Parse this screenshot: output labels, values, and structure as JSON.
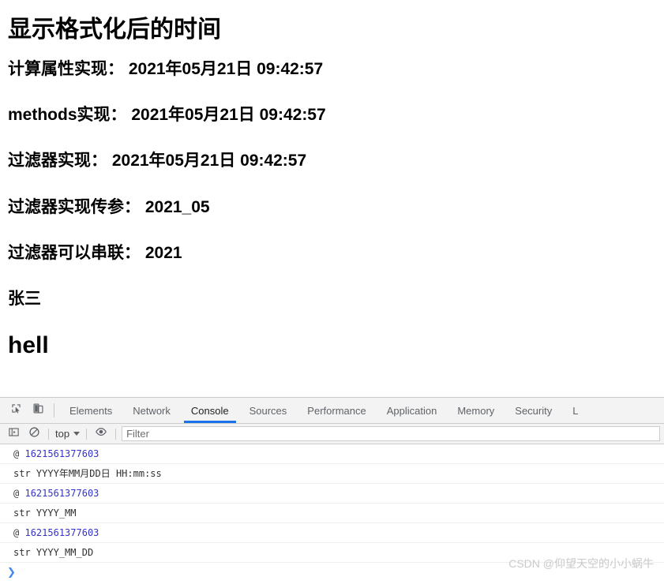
{
  "page": {
    "heading": "显示格式化后的时间",
    "lines": [
      "计算属性实现： 2021年05月21日 09:42:57",
      "methods实现： 2021年05月21日 09:42:57",
      "过滤器实现： 2021年05月21日 09:42:57",
      "过滤器实现传参： 2021_05",
      "过滤器可以串联： 2021"
    ],
    "name_line": "张三",
    "heading2": "hell"
  },
  "devtools": {
    "icons": {
      "inspect": "inspect-element-icon",
      "device": "device-toolbar-icon",
      "sidebar": "console-sidebar-icon",
      "clear": "clear-console-icon",
      "eye": "live-expression-eye-icon",
      "caret": "chevron-down-icon"
    },
    "tabs": [
      {
        "label": "Elements",
        "active": false
      },
      {
        "label": "Network",
        "active": false
      },
      {
        "label": "Console",
        "active": true
      },
      {
        "label": "Sources",
        "active": false
      },
      {
        "label": "Performance",
        "active": false
      },
      {
        "label": "Application",
        "active": false
      },
      {
        "label": "Memory",
        "active": false
      },
      {
        "label": "Security",
        "active": false
      },
      {
        "label": "L",
        "active": false
      }
    ],
    "active_tab_underline_color": "#1a73e8",
    "context_selector": "top",
    "filter_placeholder": "Filter",
    "filter_value": "",
    "messages": [
      {
        "prefix": "@",
        "value": "1621561377603",
        "kind": "number"
      },
      {
        "prefix": "str",
        "value": "YYYY年MM月DD日 HH:mm:ss",
        "kind": "string"
      },
      {
        "prefix": "@",
        "value": "1621561377603",
        "kind": "number"
      },
      {
        "prefix": "str",
        "value": "YYYY_MM",
        "kind": "string"
      },
      {
        "prefix": "@",
        "value": "1621561377603",
        "kind": "number"
      },
      {
        "prefix": "str",
        "value": "YYYY_MM_DD",
        "kind": "string"
      }
    ],
    "prompt_symbol": "❯"
  },
  "watermark": "CSDN @仰望天空的小小蜗牛"
}
